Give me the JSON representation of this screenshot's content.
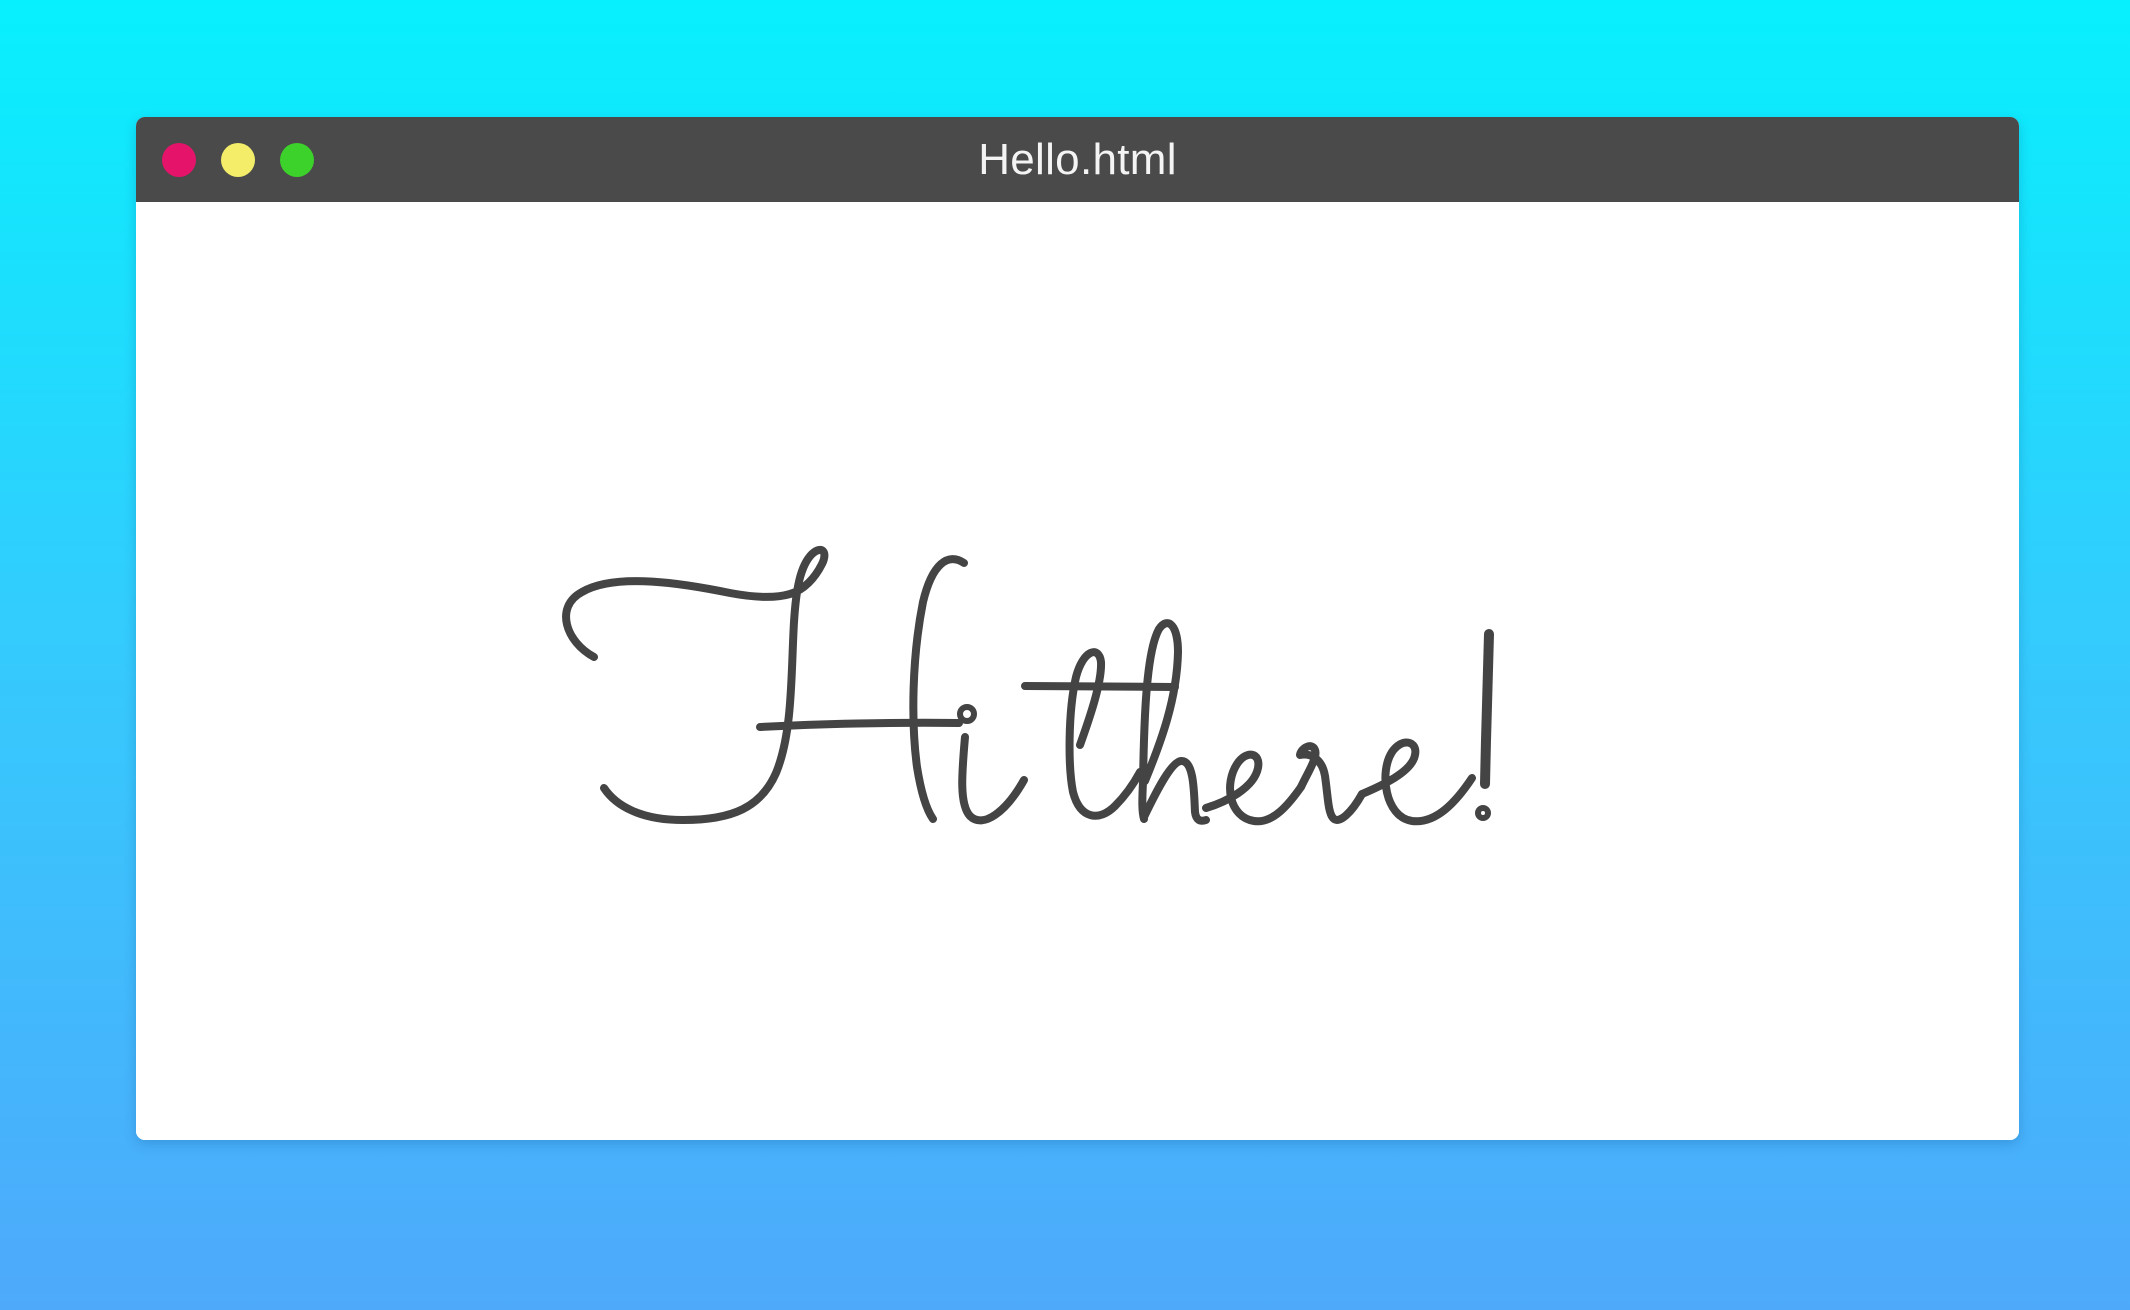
{
  "window": {
    "title": "Hello.html"
  },
  "controls": {
    "close_color": "#e6136a",
    "minimize_color": "#f3ed6a",
    "maximize_color": "#3dd12b"
  },
  "content": {
    "greeting": "Hi there!",
    "ink_color": "#444444"
  },
  "background": {
    "top_color": "#07f0fd",
    "bottom_color": "#4ea9fb"
  }
}
